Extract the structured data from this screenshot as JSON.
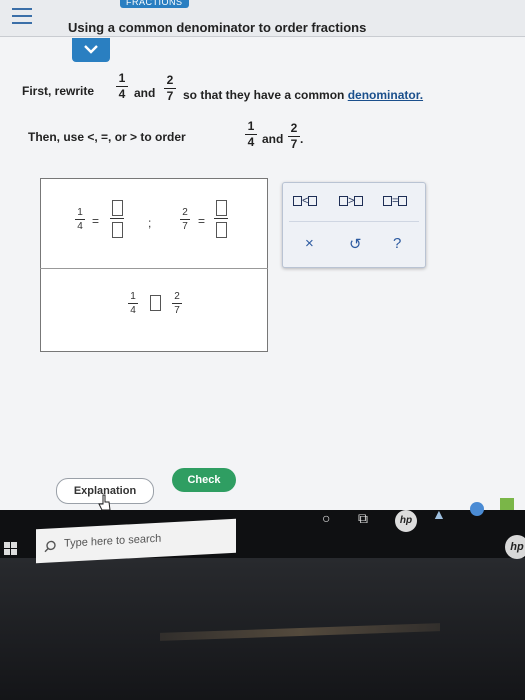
{
  "header": {
    "section_tag": "FRACTIONS",
    "title": "Using a common denominator to order fractions"
  },
  "question": {
    "line1_start": "First, rewrite",
    "and": "and",
    "line1_end": "so that they have a common",
    "denominator_link": "denominator.",
    "line2_start": "Then, use <, =, or > to order",
    "line2_end": ".",
    "fraction_a": {
      "num": "1",
      "den": "4"
    },
    "fraction_b": {
      "num": "2",
      "den": "7"
    }
  },
  "answer": {
    "equals": "=",
    "separator": ";",
    "fraction_a": {
      "num": "1",
      "den": "4"
    },
    "fraction_b": {
      "num": "2",
      "den": "7"
    }
  },
  "palette": {
    "less_than": "<",
    "greater_than": ">",
    "equal": "=",
    "clear": "×",
    "undo": "↺",
    "help": "?"
  },
  "buttons": {
    "explanation": "Explanation",
    "check": "Check"
  },
  "taskbar": {
    "search_placeholder": "Type here to search",
    "hp_logo": "hp"
  },
  "colors": {
    "accent_blue": "#2a7fc1",
    "check_green": "#2f9e62"
  }
}
